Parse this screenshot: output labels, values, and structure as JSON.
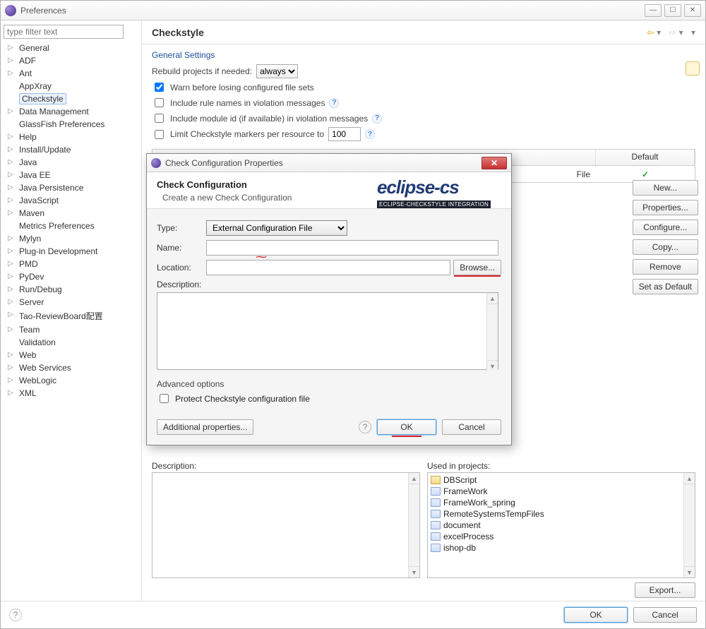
{
  "window": {
    "title": "Preferences"
  },
  "sidebar": {
    "filter_placeholder": "type filter text",
    "items": [
      {
        "label": "General",
        "expandable": true
      },
      {
        "label": "ADF",
        "expandable": true
      },
      {
        "label": "Ant",
        "expandable": true
      },
      {
        "label": "AppXray",
        "expandable": false
      },
      {
        "label": "Checkstyle",
        "expandable": false,
        "selected": true
      },
      {
        "label": "Data Management",
        "expandable": true
      },
      {
        "label": "GlassFish Preferences",
        "expandable": false
      },
      {
        "label": "Help",
        "expandable": true
      },
      {
        "label": "Install/Update",
        "expandable": true
      },
      {
        "label": "Java",
        "expandable": true
      },
      {
        "label": "Java EE",
        "expandable": true
      },
      {
        "label": "Java Persistence",
        "expandable": true
      },
      {
        "label": "JavaScript",
        "expandable": true
      },
      {
        "label": "Maven",
        "expandable": true
      },
      {
        "label": "Metrics Preferences",
        "expandable": false
      },
      {
        "label": "Mylyn",
        "expandable": true
      },
      {
        "label": "Plug-in Development",
        "expandable": true
      },
      {
        "label": "PMD",
        "expandable": true
      },
      {
        "label": "PyDev",
        "expandable": true
      },
      {
        "label": "Run/Debug",
        "expandable": true
      },
      {
        "label": "Server",
        "expandable": true
      },
      {
        "label": "Tao-ReviewBoard配置",
        "expandable": true
      },
      {
        "label": "Team",
        "expandable": true
      },
      {
        "label": "Validation",
        "expandable": false
      },
      {
        "label": "Web",
        "expandable": true
      },
      {
        "label": "Web Services",
        "expandable": true
      },
      {
        "label": "WebLogic",
        "expandable": true
      },
      {
        "label": "XML",
        "expandable": true
      }
    ]
  },
  "page": {
    "title": "Checkstyle",
    "general_legend": "General Settings",
    "rebuild_label": "Rebuild projects if needed:",
    "rebuild_value": "always",
    "warn_label": "Warn before losing configured file sets",
    "include_rule_label": "Include rule names in violation messages",
    "include_module_label": "Include module id (if available) in violation messages",
    "limit_label": "Limit Checkstyle markers per resource to",
    "limit_value": "100",
    "table": {
      "default_hdr": "Default",
      "suffix_cell": "File"
    },
    "buttons": {
      "new": "New...",
      "properties": "Properties...",
      "configure": "Configure...",
      "copy": "Copy...",
      "remove": "Remove",
      "setdefault": "Set as Default",
      "export": "Export..."
    },
    "desc_label": "Description:",
    "used_label": "Used in projects:",
    "projects": [
      "DBScript",
      "FrameWork",
      "FrameWork_spring",
      "RemoteSystemsTempFiles",
      "document",
      "excelProcess",
      "ishop-db"
    ]
  },
  "modal": {
    "title": "Check Configuration Properties",
    "heading": "Check Configuration",
    "sub": "Create a new Check Configuration",
    "logo_top": "eclipse-cs",
    "logo_sub": "ECLIPSE-CHECKSTYLE INTEGRATION",
    "type_label": "Type:",
    "type_value": "External Configuration File",
    "name_label": "Name:",
    "name_value": "",
    "location_label": "Location:",
    "location_value": "",
    "browse": "Browse...",
    "description_label": "Description:",
    "adv_legend": "Advanced options",
    "protect_label": "Protect Checkstyle configuration file",
    "additional": "Additional properties...",
    "ok": "OK",
    "cancel": "Cancel"
  },
  "footer": {
    "ok": "OK",
    "cancel": "Cancel"
  }
}
